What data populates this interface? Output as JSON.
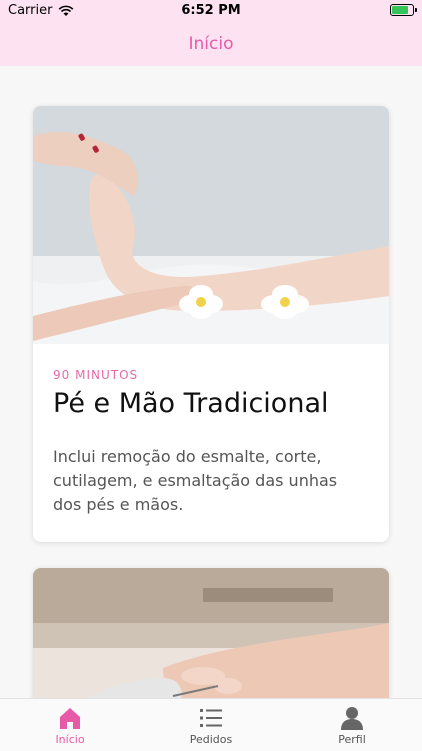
{
  "status_bar": {
    "carrier": "Carrier",
    "time": "6:52 PM"
  },
  "nav": {
    "title": "Início"
  },
  "services": [
    {
      "duration": "90 MINUTOS",
      "title": "Pé e Mão Tradicional",
      "description": "Inclui remoção do esmalte, corte, cutilagem, e esmaltação das unhas dos pés e mãos."
    }
  ],
  "tabs": [
    {
      "label": "Início",
      "icon": "home-icon",
      "active": true
    },
    {
      "label": "Pedidos",
      "icon": "list-icon",
      "active": false
    },
    {
      "label": "Perfil",
      "icon": "person-icon",
      "active": false
    }
  ],
  "colors": {
    "accent": "#e65aa7",
    "header_bg": "#fde3f1",
    "battery": "#36c45a"
  }
}
